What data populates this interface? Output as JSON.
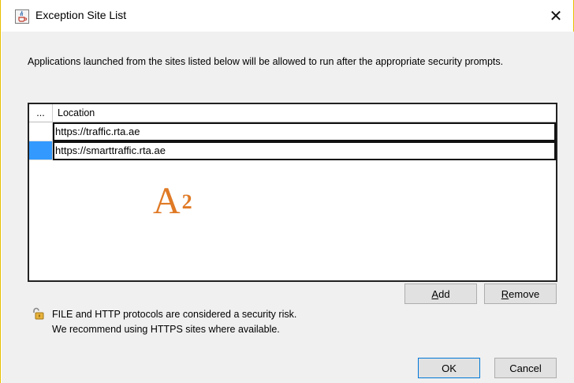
{
  "window": {
    "title": "Exception Site List",
    "close_glyph": "✕"
  },
  "description": "Applications launched from the sites listed below will be allowed to run after the appropriate security prompts.",
  "table": {
    "columns": [
      "...",
      "Location"
    ],
    "rows": [
      {
        "location": "https://traffic.rta.ae",
        "selected": false
      },
      {
        "location": "https://smarttraffic.rta.ae",
        "selected": true
      }
    ]
  },
  "watermark": {
    "letter": "A",
    "number": "2",
    "color": "#e07a26"
  },
  "buttons": {
    "add_first": "A",
    "add_rest": "dd",
    "remove_first": "R",
    "remove_rest": "emove",
    "ok": "OK",
    "cancel": "Cancel"
  },
  "warning": {
    "line1": "FILE and HTTP protocols are considered a security risk.",
    "line2": "We recommend using HTTPS sites where available."
  },
  "icons": {
    "title_icon": "java-cup-icon",
    "close_icon": "close-icon",
    "warning_icon": "unlocked-padlock-icon"
  },
  "colors": {
    "selection": "#3399ff",
    "window_border": "#e6c000",
    "default_button_border": "#0078d7"
  }
}
